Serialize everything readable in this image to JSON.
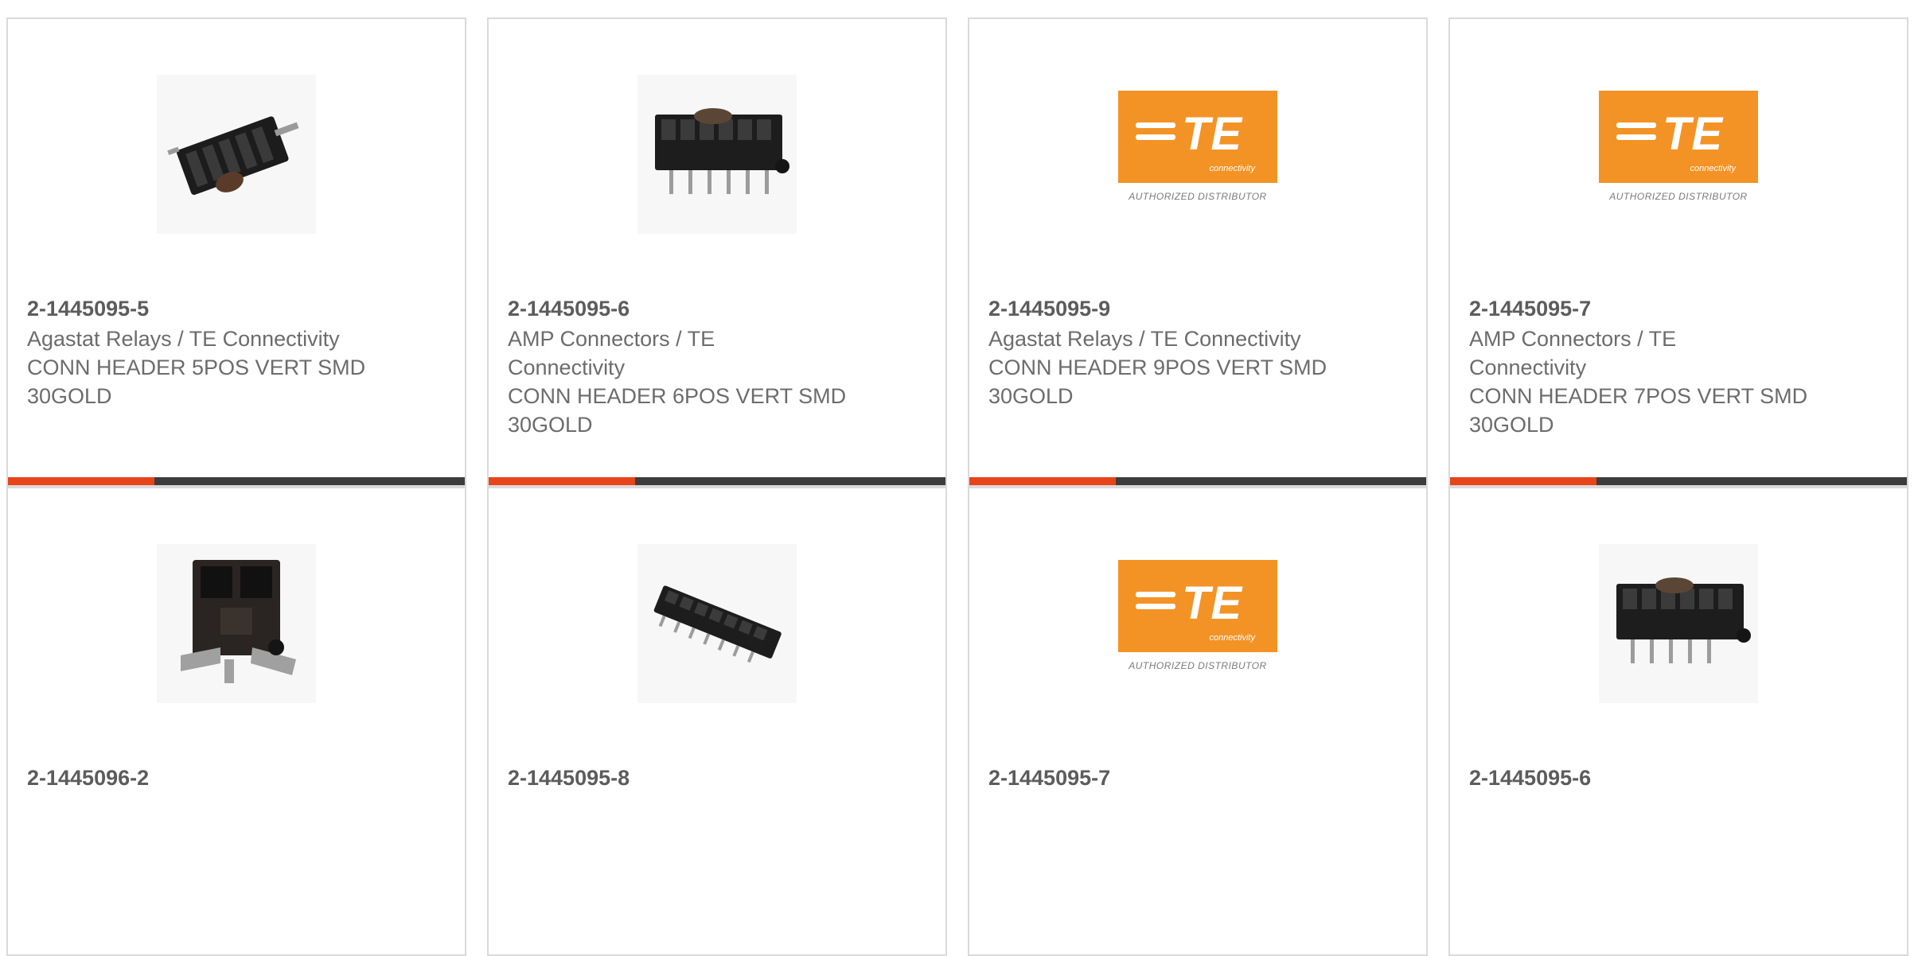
{
  "cards": [
    {
      "part_number": "2-1445095-5",
      "manufacturer": "Agastat Relays / TE Connectivity",
      "description": "CONN HEADER 5POS VERT SMD 30GOLD",
      "image": "connector-photo"
    },
    {
      "part_number": "2-1445095-6",
      "manufacturer": "AMP Connectors / TE Connectivity",
      "description": "CONN HEADER 6POS VERT SMD 30GOLD",
      "image": "connector-photo"
    },
    {
      "part_number": "2-1445095-9",
      "manufacturer": "Agastat Relays / TE Connectivity",
      "description": "CONN HEADER 9POS VERT SMD 30GOLD",
      "image": "te-logo"
    },
    {
      "part_number": "2-1445095-7",
      "manufacturer": "AMP Connectors / TE Connectivity",
      "description": "CONN HEADER 7POS VERT SMD 30GOLD",
      "image": "te-logo"
    },
    {
      "part_number": "2-1445096-2",
      "manufacturer": "",
      "description": "",
      "image": "connector-photo"
    },
    {
      "part_number": "2-1445095-8",
      "manufacturer": "",
      "description": "",
      "image": "connector-photo"
    },
    {
      "part_number": "2-1445095-7",
      "manufacturer": "",
      "description": "",
      "image": "te-logo"
    },
    {
      "part_number": "2-1445095-6",
      "manufacturer": "",
      "description": "",
      "image": "connector-photo"
    }
  ],
  "te_logo": {
    "mark": "TE",
    "subtitle": "connectivity",
    "tagline": "AUTHORIZED DISTRIBUTOR"
  },
  "colors": {
    "accent": "#e8441a",
    "bar": "#3c3c3c",
    "te_orange": "#f39325"
  }
}
